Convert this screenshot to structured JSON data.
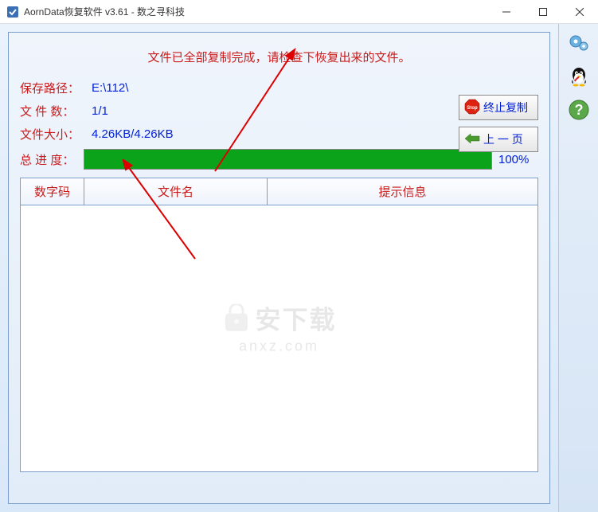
{
  "window": {
    "title": "AornData恢复软件 v3.61   - 数之寻科技"
  },
  "status_message": "文件已全部复制完成，请检查下恢复出来的文件。",
  "info": {
    "save_path_label": "保存路径：",
    "save_path_value": "E:\\112\\",
    "file_count_label": "文 件 数：",
    "file_count_value": "1/1",
    "file_size_label": "文件大小：",
    "file_size_value": "4.26KB/4.26KB",
    "progress_label": "总 进 度：",
    "progress_percent": "100%",
    "progress_value": 100
  },
  "table": {
    "headers": {
      "code": "数字码",
      "filename": "文件名",
      "message": "提示信息"
    }
  },
  "buttons": {
    "stop_copy": "终止复制",
    "prev_page": "上 一 页"
  },
  "watermark": {
    "text": "安下载",
    "url": "anxz.com"
  }
}
